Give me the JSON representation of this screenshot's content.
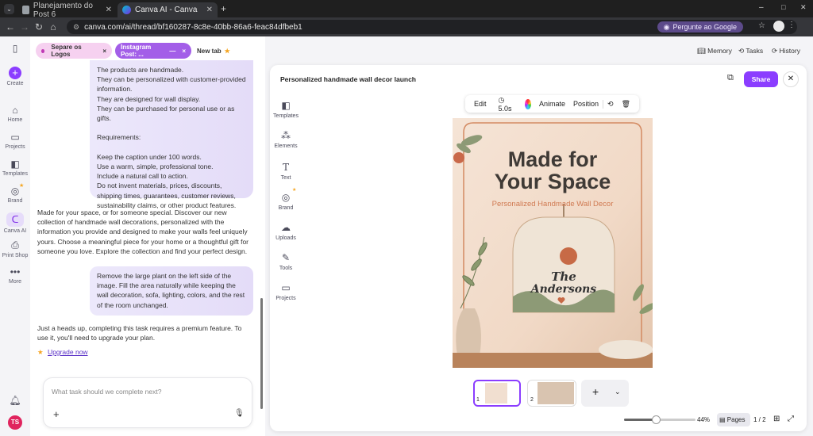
{
  "browser": {
    "tabs": [
      {
        "title": "Planejamento do Post 6",
        "active": false
      },
      {
        "title": "Canva AI - Canva",
        "active": true
      }
    ],
    "new_tab_symbol": "+",
    "url": "canva.com/ai/thread/bf160287-8c8e-40bb-86a6-feac84dfbeb1",
    "google_pill": "Pergunte ao Google",
    "window_controls": [
      "–",
      "□",
      "✕"
    ]
  },
  "rail": {
    "items": [
      {
        "label": "Create",
        "icon": "plus-icon"
      },
      {
        "label": "Home",
        "icon": "home-icon"
      },
      {
        "label": "Projects",
        "icon": "folder-icon"
      },
      {
        "label": "Templates",
        "icon": "templates-icon"
      },
      {
        "label": "Brand",
        "icon": "brand-icon"
      },
      {
        "label": "Canva AI",
        "icon": "canva-ai-icon"
      },
      {
        "label": "Print Shop",
        "icon": "print-icon"
      },
      {
        "label": "More",
        "icon": "more-icon"
      }
    ],
    "avatar_initials": "TS"
  },
  "chips": [
    {
      "label": "Separe os Logos",
      "close": "×"
    },
    {
      "label": "Instagram Post: ...",
      "minus": "—",
      "close": "×"
    },
    {
      "label": "New tab",
      "star": "★"
    }
  ],
  "header_links": {
    "memory": "Memory",
    "tasks": "Tasks",
    "history": "History"
  },
  "chat": {
    "bubble1": "The products are handmade.\nThey can be personalized with customer-provided information.\nThey are designed for wall display.\nThey can be purchased for personal use or as gifts.\n\nRequirements:\n\nKeep the caption under 100 words.\nUse a warm, simple, professional tone.\nInclude a natural call to action.\nDo not invent materials, prices, discounts, shipping times, guarantees, customer reviews, sustainability claims, or other product features.",
    "reply1": "Made for your space, or for someone special. Discover our new collection of handmade wall decorations, personalized with the information you provide and designed to make your walls feel uniquely yours. Choose a meaningful piece for your home or a thoughtful gift for someone you love. Explore the collection and find your perfect design.",
    "bubble2": "Remove the large plant on the left side of the image. Fill the area naturally while keeping the wall decoration, sofa, lighting, colors, and the rest of the room unchanged.",
    "reply2": "Just a heads up, completing this task requires a premium feature. To use it, you'll need to upgrade your plan.",
    "upgrade": "Upgrade now",
    "compose_placeholder": "What task should we complete next?"
  },
  "panel": {
    "title": "Personalized handmade wall decor launch",
    "share": "Share",
    "tools": [
      {
        "label": "Templates",
        "icon": "templates-icon"
      },
      {
        "label": "Elements",
        "icon": "elements-icon"
      },
      {
        "label": "Text",
        "icon": "text-icon"
      },
      {
        "label": "Brand",
        "icon": "brand-icon"
      },
      {
        "label": "Uploads",
        "icon": "upload-icon"
      },
      {
        "label": "Tools",
        "icon": "tools-icon"
      },
      {
        "label": "Projects",
        "icon": "folder-icon"
      }
    ],
    "context": {
      "edit": "Edit",
      "duration": "5.0s",
      "animate": "Animate",
      "position": "Position"
    },
    "design": {
      "headline1": "Made for",
      "headline2": "Your Space",
      "subhead": "Personalized Handmade Wall Decor",
      "sign1": "The",
      "sign2": "Andersons"
    },
    "pages": [
      {
        "num": "1"
      },
      {
        "num": "2"
      }
    ],
    "add_page": "+",
    "zoom": "44%",
    "zoom_fraction": 0.44,
    "pages_btn": "Pages",
    "page_count": "1 / 2"
  },
  "colors": {
    "accent": "#7d2ae8",
    "chip_pink": "#f3c8f0",
    "chip_purple": "#a35ee8",
    "headline": "#3f3a36",
    "subhead": "#d07a52"
  }
}
